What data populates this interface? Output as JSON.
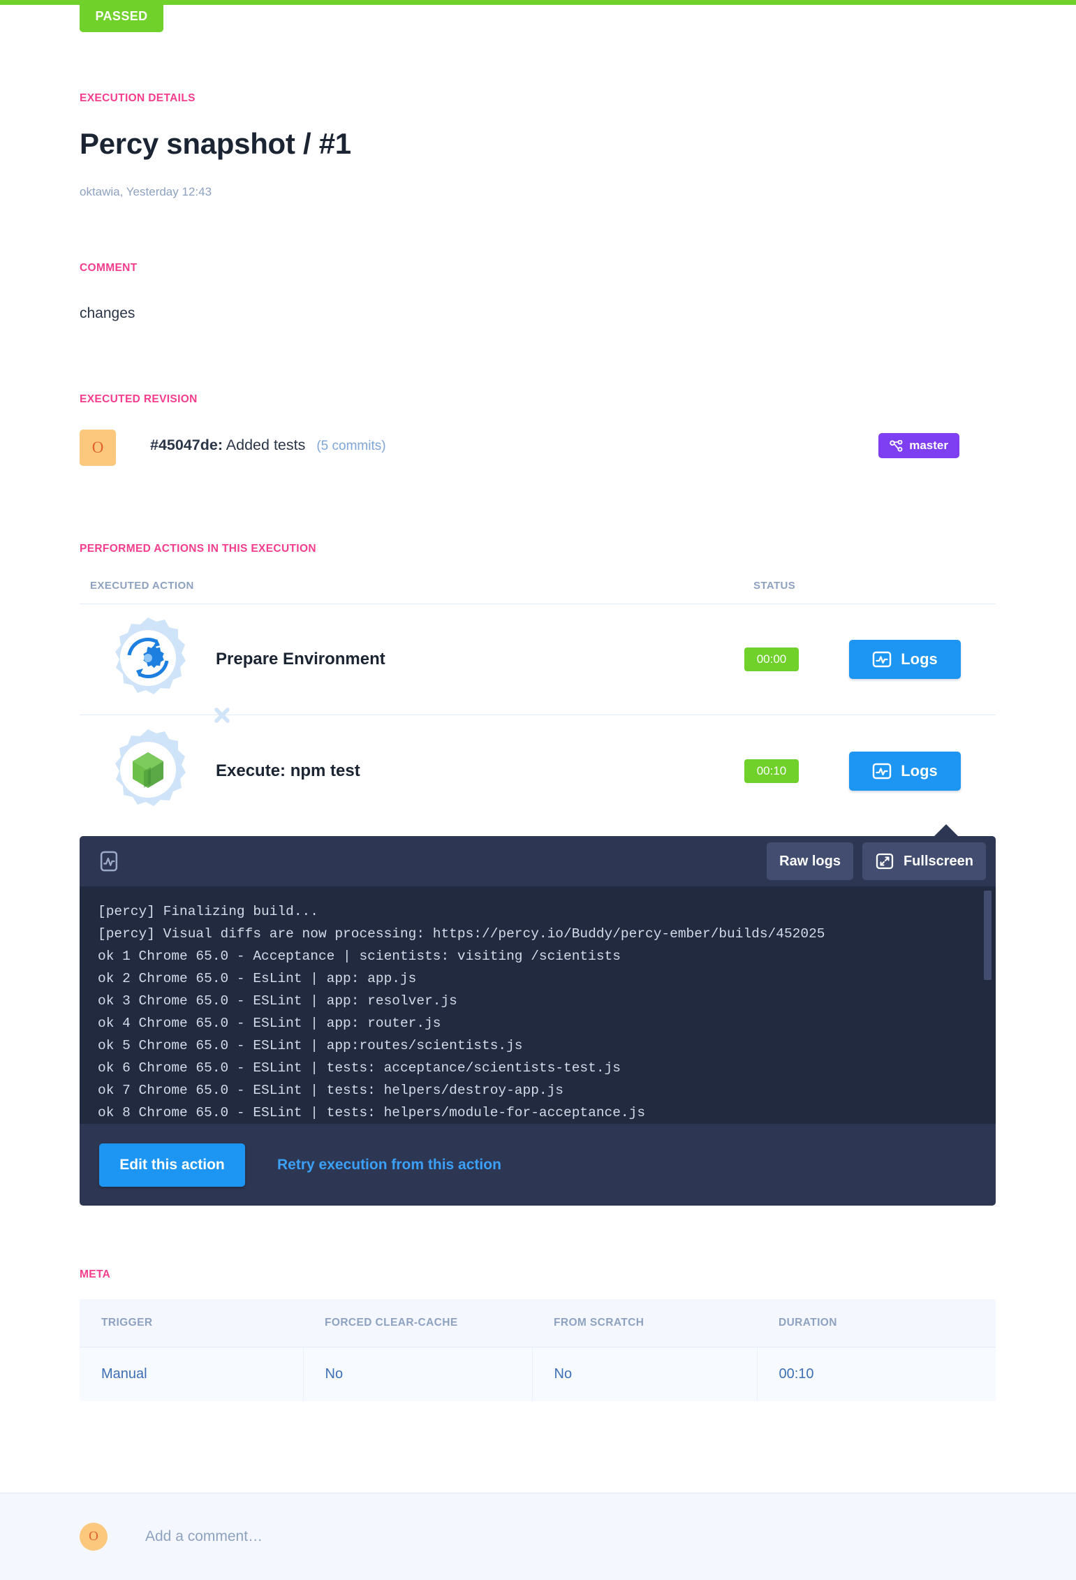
{
  "status": {
    "label": "PASSED",
    "color": "#6fd129"
  },
  "header": {
    "section_label": "EXECUTION DETAILS",
    "title": "Percy snapshot / #1",
    "subtitle": "oktawia, Yesterday 12:43"
  },
  "comment_section": {
    "label": "COMMENT",
    "text": "changes"
  },
  "revision": {
    "label": "EXECUTED REVISION",
    "avatar_initial": "O",
    "hash": "#45047de:",
    "message": "Added tests",
    "commits": "(5 commits)",
    "branch": "master",
    "branch_color": "#7e3ff2"
  },
  "actions": {
    "label": "PERFORMED ACTIONS IN THIS EXECUTION",
    "columns": {
      "action": "EXECUTED ACTION",
      "status": "STATUS"
    },
    "rows": [
      {
        "name": "Prepare Environment",
        "icon": "prepare-environment-gear-icon",
        "time": "00:00",
        "logs_label": "Logs"
      },
      {
        "name": "Execute: npm test",
        "icon": "nodejs-gear-icon",
        "time": "00:10",
        "logs_label": "Logs"
      }
    ]
  },
  "log_panel": {
    "raw_logs_label": "Raw logs",
    "fullscreen_label": "Fullscreen",
    "lines": [
      "[percy] Finalizing build...",
      "[percy] Visual diffs are now processing: https://percy.io/Buddy/percy-ember/builds/452025",
      "ok 1 Chrome 65.0 - Acceptance | scientists: visiting /scientists",
      "ok 2 Chrome 65.0 - EsLint | app: app.js",
      "ok 3 Chrome 65.0 - ESLint | app: resolver.js",
      "ok 4 Chrome 65.0 - ESLint | app: router.js",
      "ok 5 Chrome 65.0 - ESLint | app:routes/scientists.js",
      "ok 6 Chrome 65.0 - ESLint | tests: acceptance/scientists-test.js",
      "ok 7 Chrome 65.0 - ESLint | tests: helpers/destroy-app.js",
      "ok 8 Chrome 65.0 - ESLint | tests: helpers/module-for-acceptance.js"
    ],
    "edit_label": "Edit this action",
    "retry_label": "Retry execution from this action"
  },
  "meta": {
    "label": "META",
    "columns": [
      "TRIGGER",
      "FORCED CLEAR-CACHE",
      "FROM SCRATCH",
      "DURATION"
    ],
    "values": [
      "Manual",
      "No",
      "No",
      "00:10"
    ]
  },
  "footer": {
    "avatar_initial": "O",
    "comment_placeholder": "Add a comment…"
  }
}
